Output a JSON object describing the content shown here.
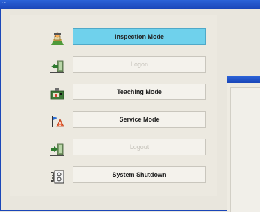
{
  "window": {
    "titlebar_text": "⁃⁃"
  },
  "menu": {
    "items": [
      {
        "label": "Inspection Mode",
        "state": "active",
        "icon": "inspection-icon"
      },
      {
        "label": "Logon",
        "state": "disabled",
        "icon": "logon-icon"
      },
      {
        "label": "Teaching Mode",
        "state": "normal",
        "icon": "teaching-icon"
      },
      {
        "label": "Service Mode",
        "state": "normal",
        "icon": "service-icon"
      },
      {
        "label": "Logout",
        "state": "disabled",
        "icon": "logout-icon"
      },
      {
        "label": "System Shutdown",
        "state": "normal",
        "icon": "shutdown-icon"
      }
    ]
  },
  "popup": {
    "titlebar_text": "⁃⁃"
  },
  "colors": {
    "titlebar": "#1a46b8",
    "active_button": "#6fd1ec",
    "background": "#e9e6dd"
  }
}
